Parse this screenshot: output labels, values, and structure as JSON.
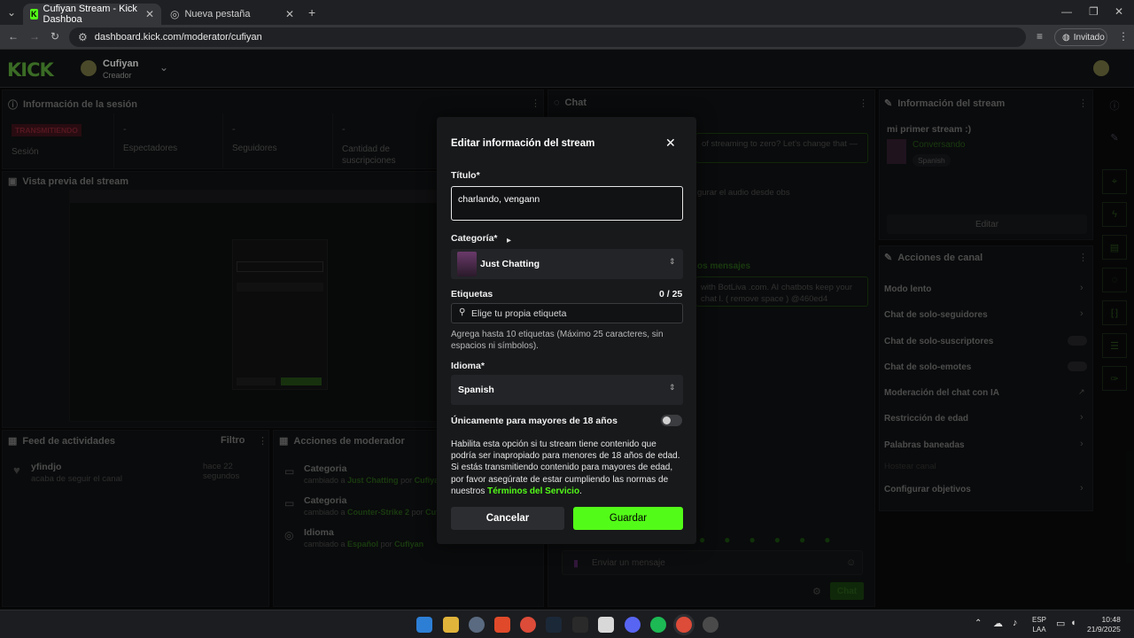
{
  "browser": {
    "tabs": [
      {
        "label": "Cufiyan Stream - Kick Dashboa",
        "active": true
      },
      {
        "label": "Nueva pestaña",
        "active": false
      }
    ],
    "url": "dashboard.kick.com/moderator/cufiyan",
    "profile_label": "Invitado"
  },
  "header": {
    "logo": "KICK",
    "user_name": "Cufiyan",
    "user_role": "Creador"
  },
  "session": {
    "title": "Información de la sesión",
    "badge": "TRANSMITIENDO",
    "session_label": "Sesión",
    "stats": [
      {
        "value": "-",
        "label": "Espectadores"
      },
      {
        "value": "-",
        "label": "Seguidores"
      },
      {
        "value": "-",
        "label": "Cantidad de suscripciones"
      }
    ]
  },
  "preview": {
    "title": "Vista previa del stream"
  },
  "activity": {
    "title": "Feed de actividades",
    "filter": "Filtro",
    "items": [
      {
        "user": "yfindjo",
        "action": "acaba de seguir el canal",
        "time": "hace 22 segundos"
      }
    ]
  },
  "mod_actions": {
    "title": "Acciones de moderador",
    "items": [
      {
        "title": "Categoria",
        "prefix": "cambiado a",
        "value": "Just Chatting",
        "by": "por",
        "user": "Cufiyan"
      },
      {
        "title": "Categoria",
        "prefix": "cambiado a",
        "value": "Counter-Strike 2",
        "by": "por",
        "user": "Cufiy"
      },
      {
        "title": "Idioma",
        "prefix": "cambiado a",
        "value": "Español",
        "by": "por",
        "user": "Cufiyan"
      }
    ]
  },
  "chat": {
    "title": "Chat",
    "msg1": "of streaming to zero? Let's change that —",
    "msg2": "gurar el audio desde obs",
    "pinned_label": "os mensajes",
    "msg3": "with BotLiva .com. AI chatbots keep your chat l. ( remove space ) @460ed4",
    "input_placeholder": "Enviar un mensaje",
    "send": "Chat"
  },
  "stream_info": {
    "title": "Información del stream",
    "stream_title": "mi primer stream :)",
    "category": "Conversando",
    "language": "Spanish",
    "edit": "Editar"
  },
  "channel_actions": {
    "title": "Acciones de canal",
    "items": [
      {
        "label": "Modo lento",
        "control": "chevron"
      },
      {
        "label": "Chat de solo-seguidores",
        "control": "chevron"
      },
      {
        "label": "Chat de solo-suscriptores",
        "control": "toggle"
      },
      {
        "label": "Chat de solo-emotes",
        "control": "toggle"
      },
      {
        "label": "Moderación del chat con IA",
        "control": "external"
      },
      {
        "label": "Restricción de edad",
        "control": "chevron"
      },
      {
        "label": "Palabras baneadas",
        "control": "chevron"
      },
      {
        "label": "Hostear canal",
        "control": "none"
      },
      {
        "label": "Configurar objetivos",
        "control": "chevron"
      }
    ]
  },
  "modal": {
    "title": "Editar información del stream",
    "title_label": "Título*",
    "title_value": "charlando, vengann",
    "category_label": "Categoría*",
    "category_value": "Just Chatting",
    "tags_label": "Etiquetas",
    "tags_count": "0 / 25",
    "tags_placeholder": "Elige tu propia etiqueta",
    "tags_hint": "Agrega hasta 10 etiquetas (Máximo 25 caracteres, sin espacios ni símbolos).",
    "language_label": "Idioma*",
    "language_value": "Spanish",
    "adult_label": "Únicamente para mayores de 18 años",
    "adult_text": "Habilita esta opción si tu stream tiene contenido que podría ser inapropiado para menores de 18 años de edad. Si estás transmitiendo contenido para mayores de edad, por favor asegúrate de estar cumpliendo las normas de nuestros",
    "adult_link": "Términos del Servicio",
    "cancel": "Cancelar",
    "save": "Guardar"
  },
  "taskbar": {
    "lang1": "ESP",
    "lang2": "LAA",
    "time": "10:48",
    "date": "21/9/2025"
  },
  "colors": {
    "kick_green": "#53fc18",
    "live_red": "#e0314b"
  }
}
